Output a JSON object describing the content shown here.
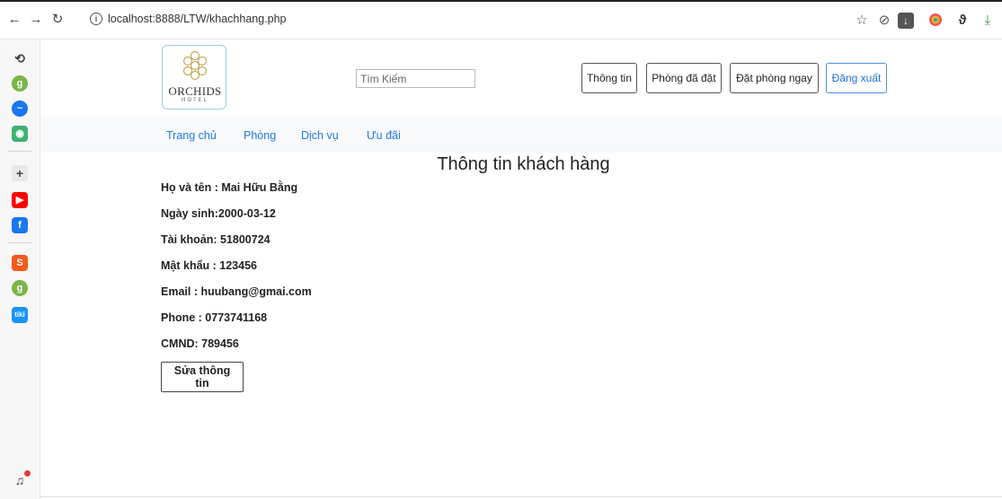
{
  "browser": {
    "url": "localhost:8888/LTW/khachhang.php"
  },
  "logo": {
    "name": "ORCHIDS",
    "subtitle": "HOTEL"
  },
  "search": {
    "placeholder": "Tìm Kiếm"
  },
  "header_buttons": {
    "info": "Thông tin",
    "booked_rooms": "Phòng đã đặt",
    "book_now": "Đặt phòng ngay",
    "logout": "Đăng xuất"
  },
  "nav": {
    "home": "Trang chủ",
    "rooms": "Phòng",
    "services": "Dịch vụ",
    "offers": "Ưu đãi"
  },
  "page_title": "Thông tin khách hàng",
  "customer": {
    "name": "Họ và tên : Mai Hữu Bằng",
    "dob": "Ngày sinh:2000-03-12",
    "account": "Tài khoản: 51800724",
    "password": "Mật khẩu : 123456",
    "email": "Email : huubang@gmai.com",
    "phone": "Phone : 0773741168",
    "id_card": "CMND: 789456"
  },
  "edit_button": "Sửa thông tin",
  "colors": {
    "link": "#1f7ae0",
    "primary_button": "#1f6fd1",
    "navbar_bg": "#f8f9fa"
  }
}
